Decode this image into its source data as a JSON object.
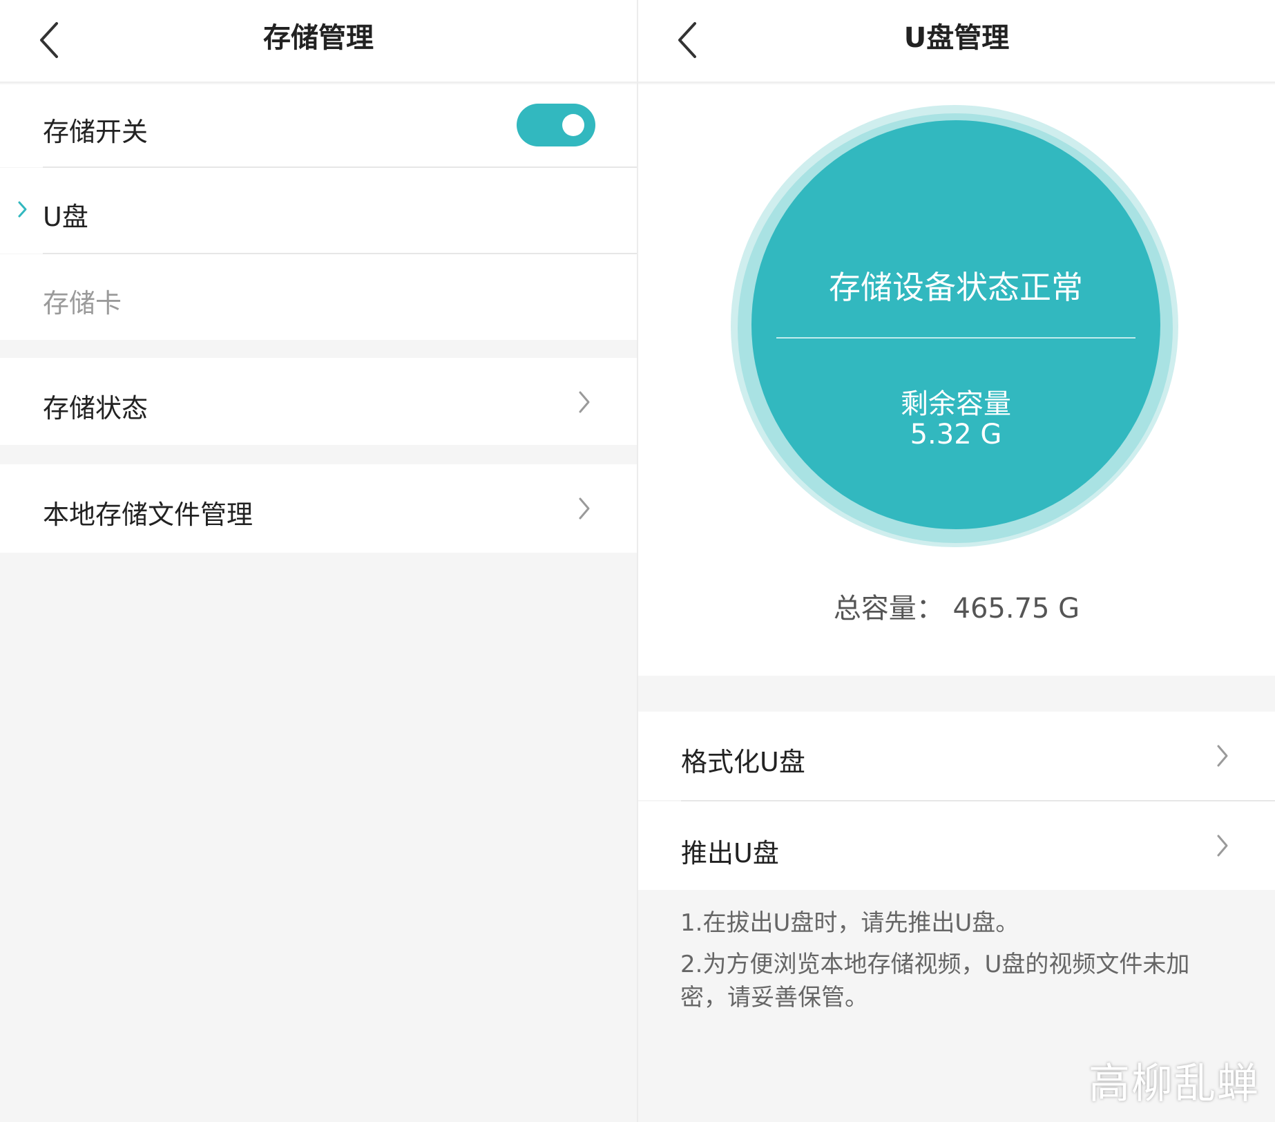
{
  "left": {
    "header": {
      "title": "存储管理"
    },
    "storage_switch": {
      "label": "存储开关",
      "state": "on"
    },
    "options": [
      {
        "label": "U盘",
        "selected": true
      },
      {
        "label": "存储卡",
        "selected": false
      }
    ],
    "storage_status": {
      "label": "存储状态"
    },
    "local_files": {
      "label": "本地存储文件管理"
    }
  },
  "right": {
    "header": {
      "title": "U盘管理"
    },
    "status_circle": {
      "status": "存储设备状态正常",
      "remaining_label": "剩余容量",
      "remaining_value": "5.32 G"
    },
    "total_capacity": "总容量：  465.75 G",
    "actions": [
      {
        "label": "格式化U盘"
      },
      {
        "label": "推出U盘"
      }
    ],
    "notes": [
      "1.在拔出U盘时，请先推出U盘。",
      "2.为方便浏览本地存储视频，U盘的视频文件未加密，请妥善保管。"
    ]
  },
  "watermark": "高柳乱蝉",
  "colors": {
    "accent": "#32b8bf",
    "background": "#f5f5f5",
    "card": "#ffffff"
  },
  "icons": {
    "back": "chevron-left-icon",
    "forward": "chevron-right-icon"
  }
}
